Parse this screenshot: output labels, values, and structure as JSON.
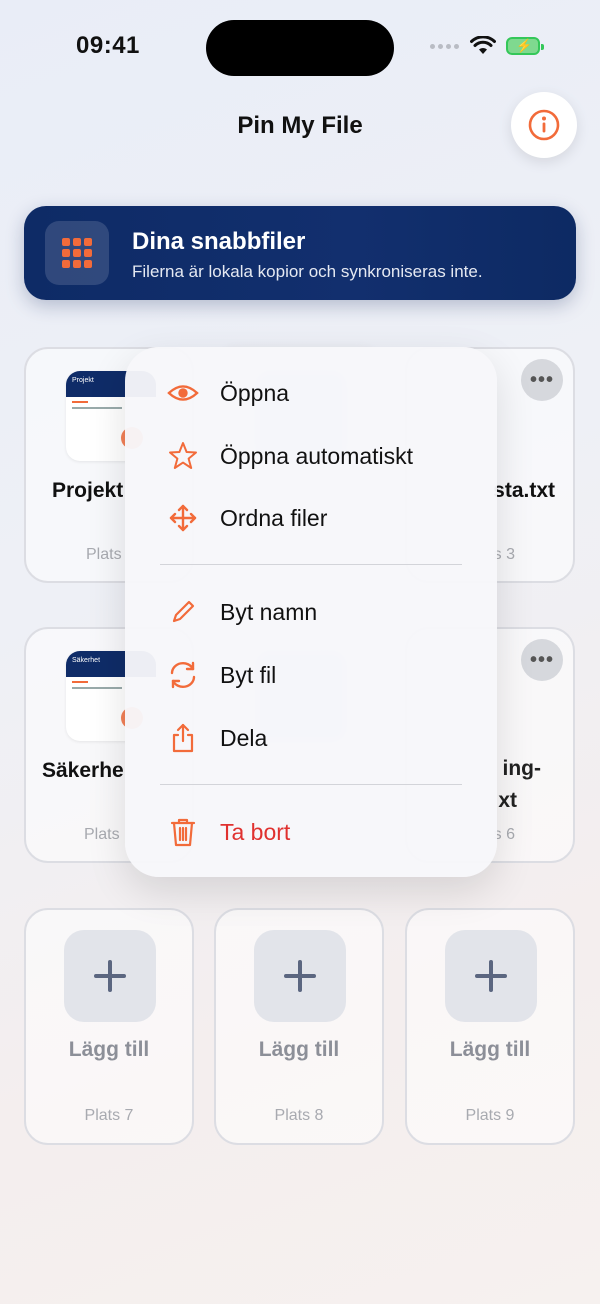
{
  "status": {
    "time": "09:41"
  },
  "app": {
    "title": "Pin My File"
  },
  "banner": {
    "title": "Dina snabbfiler",
    "subtitle": "Filerna är lokala kopior och synkroniseras inte."
  },
  "slots": [
    {
      "name": "Projekt",
      "plats": "Plats",
      "thumb_title": "Projekt"
    },
    {
      "name": "sta.txt",
      "plats": "s 3"
    },
    {
      "name": "Säkerhe",
      "plats": "Plats",
      "thumb_title": "Säkerhet"
    },
    {
      "name_line1": "ing-",
      "name_line2": "xt",
      "plats": "s 6"
    },
    {
      "add_label": "Lägg till",
      "plats": "Plats 7"
    },
    {
      "add_label": "Lägg till",
      "plats": "Plats 8"
    },
    {
      "add_label": "Lägg till",
      "plats": "Plats 9"
    }
  ],
  "menu": {
    "items": [
      {
        "label": "Öppna",
        "icon": "eye-icon"
      },
      {
        "label": "Öppna automatiskt",
        "icon": "star-icon"
      },
      {
        "label": "Ordna filer",
        "icon": "move-arrows-icon"
      },
      {
        "label": "Byt namn",
        "icon": "pencil-icon"
      },
      {
        "label": "Byt fil",
        "icon": "replace-arrows-icon"
      },
      {
        "label": "Dela",
        "icon": "share-icon"
      },
      {
        "label": "Ta bort",
        "icon": "trash-icon"
      }
    ]
  },
  "colors": {
    "accent": "#f26b3a",
    "navy": "#0e2b66",
    "danger": "#e0312f"
  }
}
